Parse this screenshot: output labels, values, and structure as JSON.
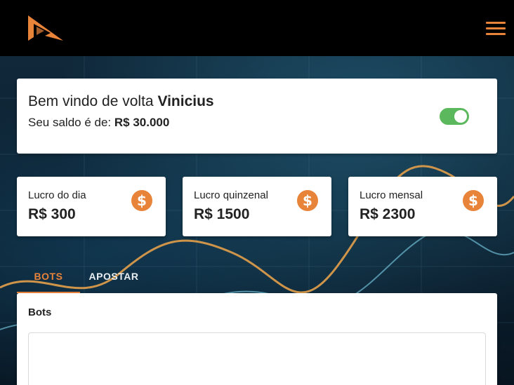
{
  "header": {
    "logo_icon": "play-arrow-logo-icon",
    "menu_icon": "hamburger-menu-icon",
    "brand_color": "#e8833a"
  },
  "welcome": {
    "greeting": "Bem vindo de volta",
    "user_name": "Vinicius",
    "balance_label": "Seu saldo é de:",
    "balance_value": "R$ 30.000",
    "toggle_on": true,
    "toggle_color": "#5cb85c"
  },
  "stats": [
    {
      "label": "Lucro do dia",
      "value": "R$ 300",
      "icon": "dollar-coin-icon"
    },
    {
      "label": "Lucro quinzenal",
      "value": "R$ 1500",
      "icon": "dollar-coin-icon"
    },
    {
      "label": "Lucro mensal",
      "value": "R$ 2300",
      "icon": "dollar-coin-icon"
    }
  ],
  "tabs": [
    {
      "label": "BOTS",
      "active": true
    },
    {
      "label": "APOSTAR",
      "active": false
    }
  ],
  "panel": {
    "title": "Bots"
  }
}
